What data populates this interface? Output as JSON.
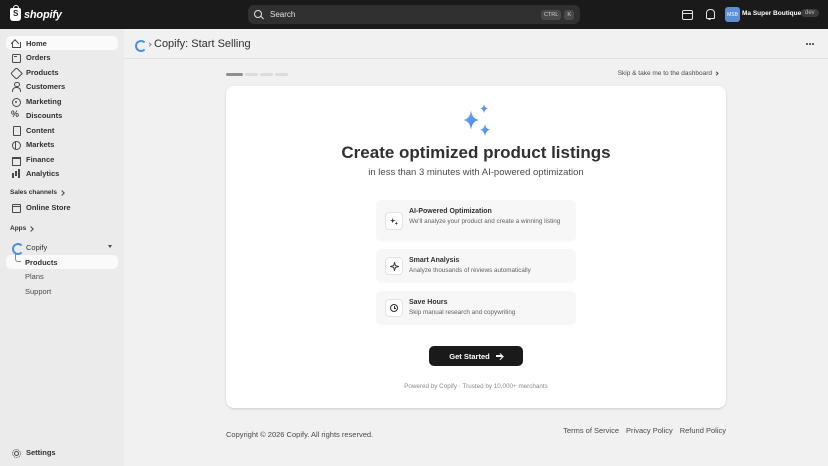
{
  "topbar": {
    "brand": "shopify",
    "search_label": "Search",
    "shortcut_keys": [
      "CTRL",
      "K"
    ],
    "avatar_initials": "MSB",
    "store_name": "Ma Super Boutique",
    "env_badge": "dev"
  },
  "sidebar": {
    "main_items": [
      {
        "label": "Home",
        "icon": "house-icon"
      },
      {
        "label": "Orders",
        "icon": "inbox-icon"
      },
      {
        "label": "Products",
        "icon": "tag-icon"
      },
      {
        "label": "Customers",
        "icon": "person-icon"
      },
      {
        "label": "Marketing",
        "icon": "target-icon"
      },
      {
        "label": "Discounts",
        "icon": "percent-icon"
      },
      {
        "label": "Content",
        "icon": "page-icon"
      },
      {
        "label": "Markets",
        "icon": "globe-icon"
      },
      {
        "label": "Finance",
        "icon": "bank-icon"
      },
      {
        "label": "Analytics",
        "icon": "bar-chart-icon"
      }
    ],
    "sales_channels_label": "Sales channels",
    "online_store_label": "Online Store",
    "apps_label": "Apps",
    "app_name": "Copify",
    "app_subitems": [
      "Products",
      "Plans",
      "Support"
    ],
    "settings_label": "Settings"
  },
  "header": {
    "page_title": "Copify: Start Selling"
  },
  "onboarding": {
    "skip_label": "Skip & take me to the dashboard",
    "steps_total": 4,
    "current_step": 1,
    "title": "Create optimized product listings",
    "subtitle": "in less than 3 minutes with AI-powered optimization",
    "features": [
      {
        "title": "AI-Powered Optimization",
        "desc": "We'll analyze your product and create a winning listing",
        "icon": "sparkles-icon"
      },
      {
        "title": "Smart Analysis",
        "desc": "Analyze thousands of reviews automatically",
        "icon": "sparkle-icon"
      },
      {
        "title": "Save Hours",
        "desc": "Skip manual research and copywriting",
        "icon": "clock-icon"
      }
    ],
    "cta_label": "Get Started",
    "powered_by": "Powered by Copify · Trusted by 10,000+ merchants"
  },
  "footer": {
    "copyright": "Copyright © 2026 Copify. All rights reserved.",
    "links": [
      "Terms of Service",
      "Privacy Policy",
      "Refund Policy"
    ]
  },
  "colors": {
    "accent": "#4a90e2",
    "topbar": "#1a1a1a",
    "cta": "#1a1a1a"
  }
}
